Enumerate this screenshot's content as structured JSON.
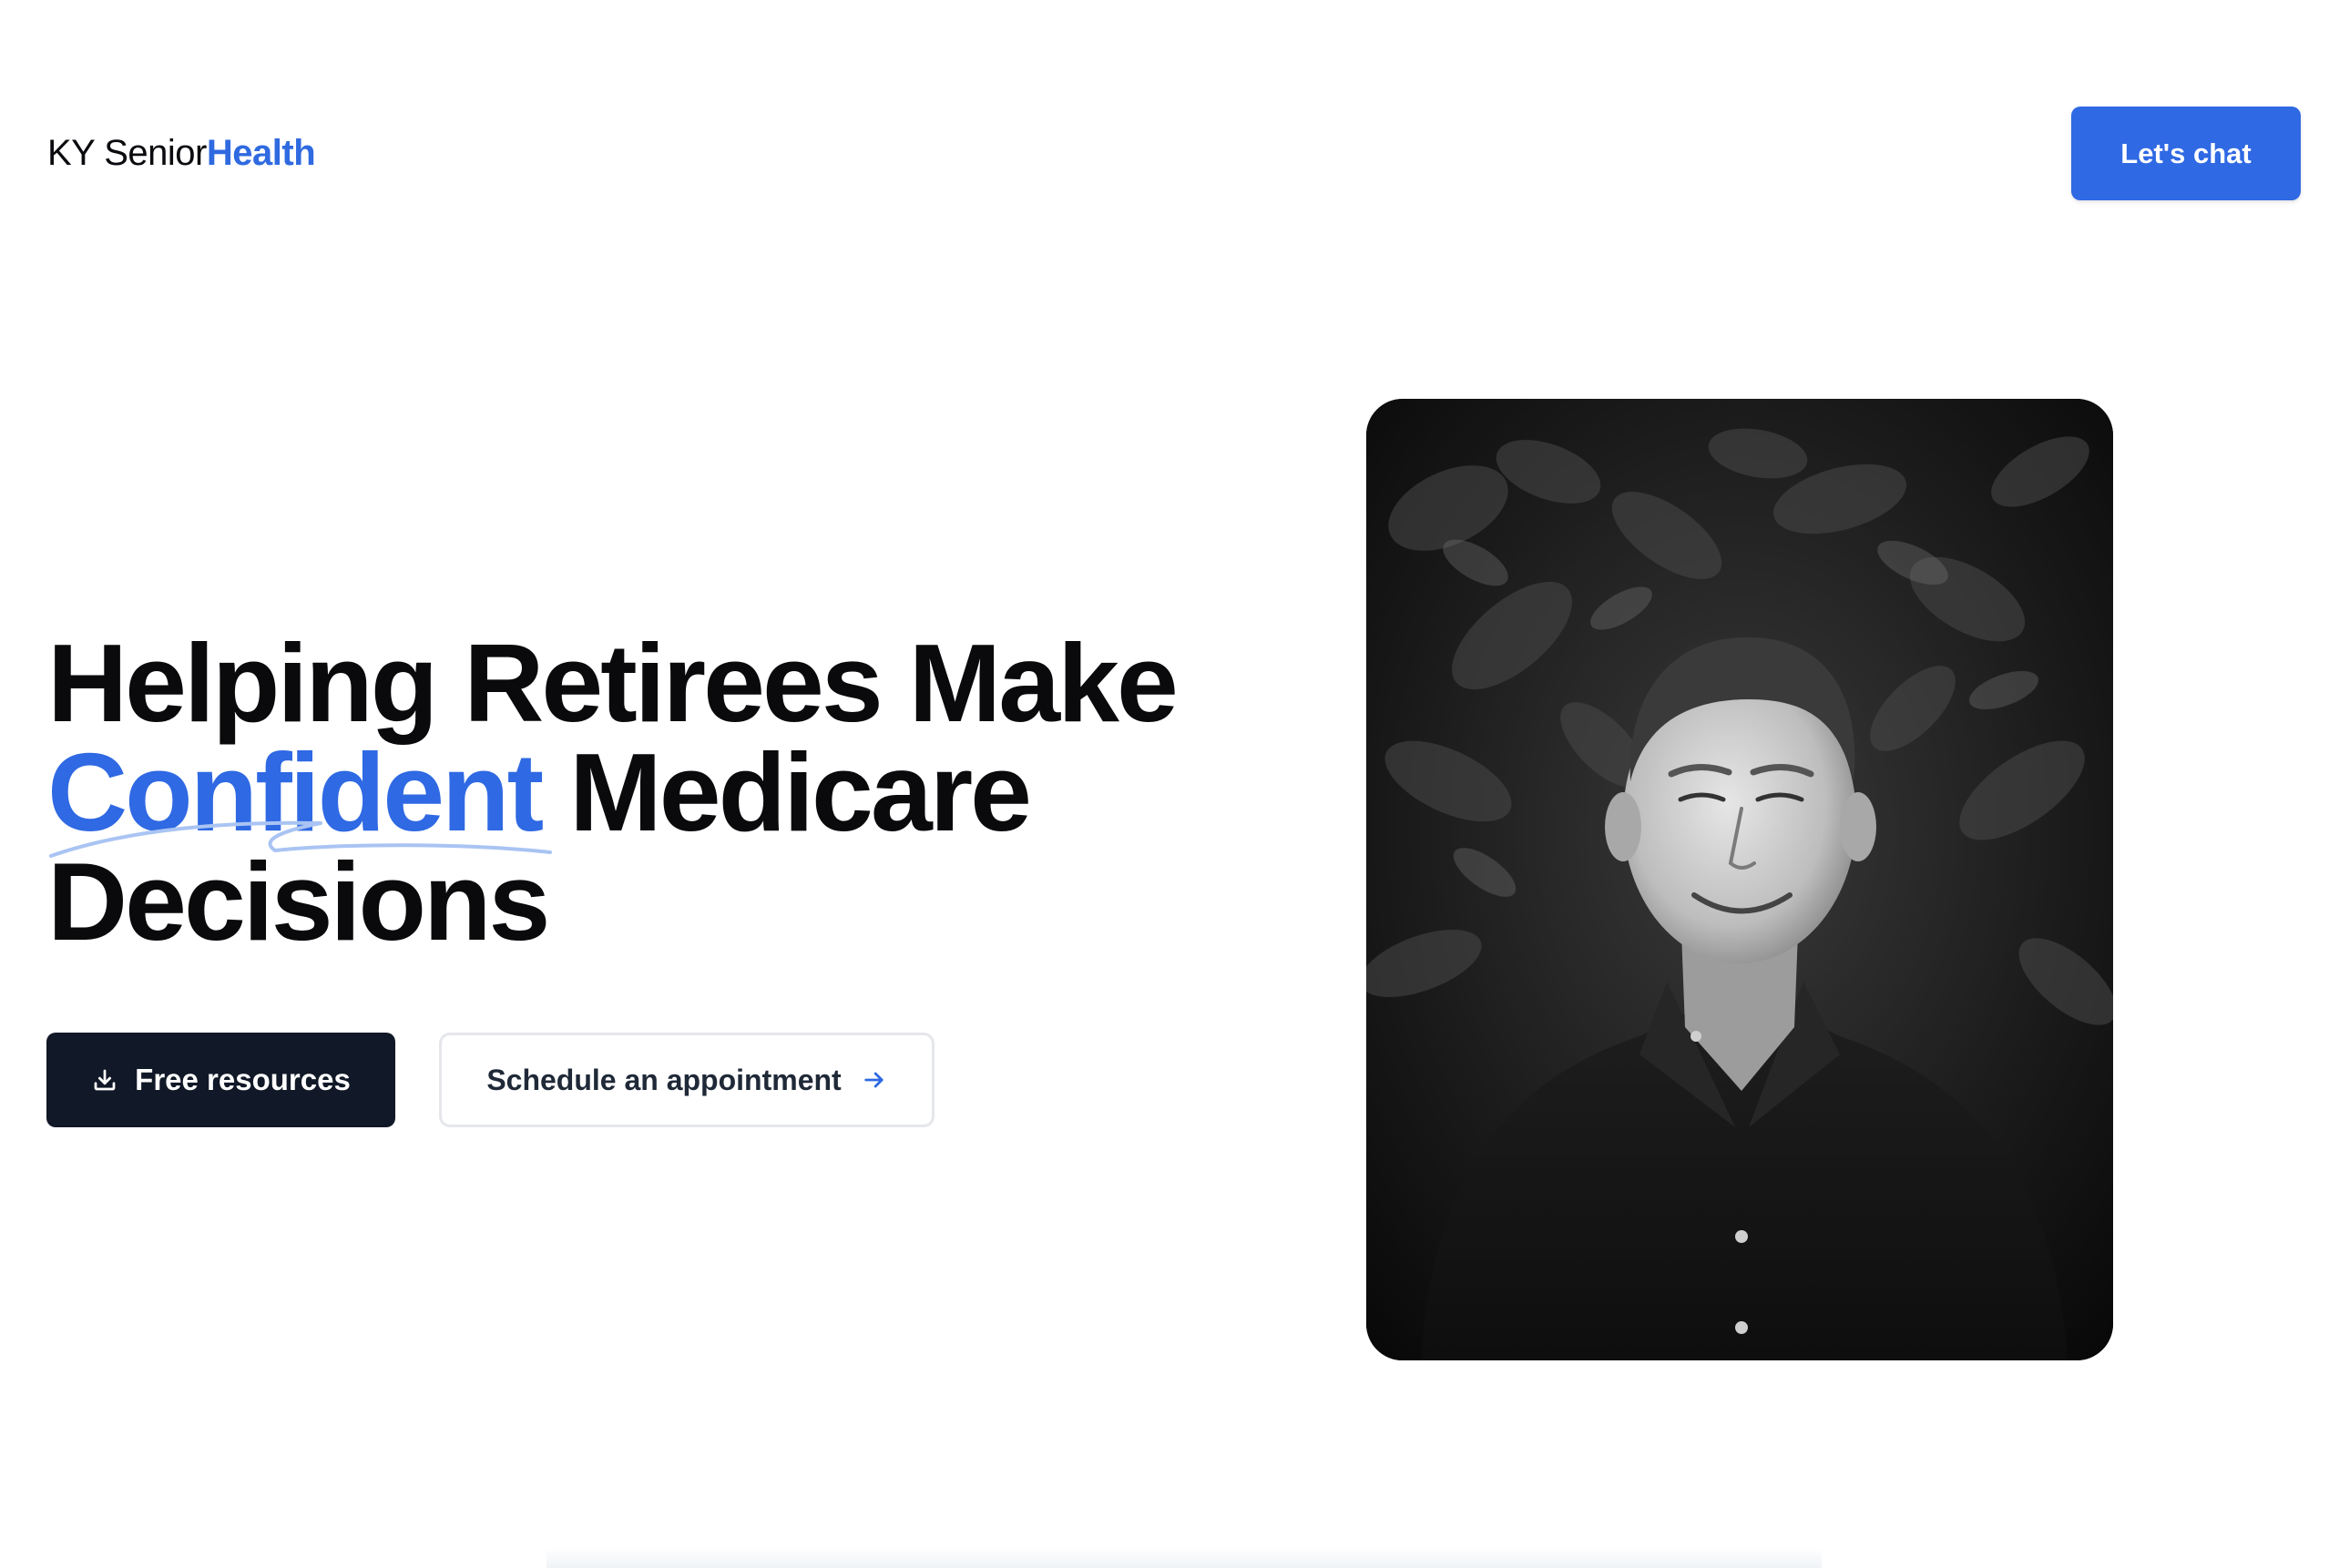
{
  "header": {
    "logo_prefix": "KY Senior",
    "logo_accent": "Health",
    "cta_label": "Let's chat"
  },
  "hero": {
    "title_line1": "Helping Retirees Make",
    "title_highlight": "Confident",
    "title_line2_rest": " Medicare",
    "title_line3": "Decisions",
    "primary_button": "Free resources",
    "secondary_button": "Schedule an appointment"
  },
  "icons": {
    "primary_button_icon": "download-icon",
    "secondary_button_icon": "arrow-right-icon"
  },
  "colors": {
    "accent": "#2f69e3",
    "dark_button": "#111827",
    "text": "#0a0a0c"
  }
}
